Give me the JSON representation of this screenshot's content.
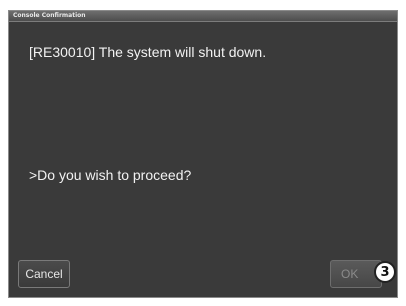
{
  "dialog": {
    "title": "Console Confirmation",
    "message": "[RE30010] The system will shut down.",
    "prompt": ">Do you wish to proceed?",
    "cancel_label": "Cancel",
    "ok_label": "OK"
  },
  "annotation": {
    "callout_number": "3"
  }
}
